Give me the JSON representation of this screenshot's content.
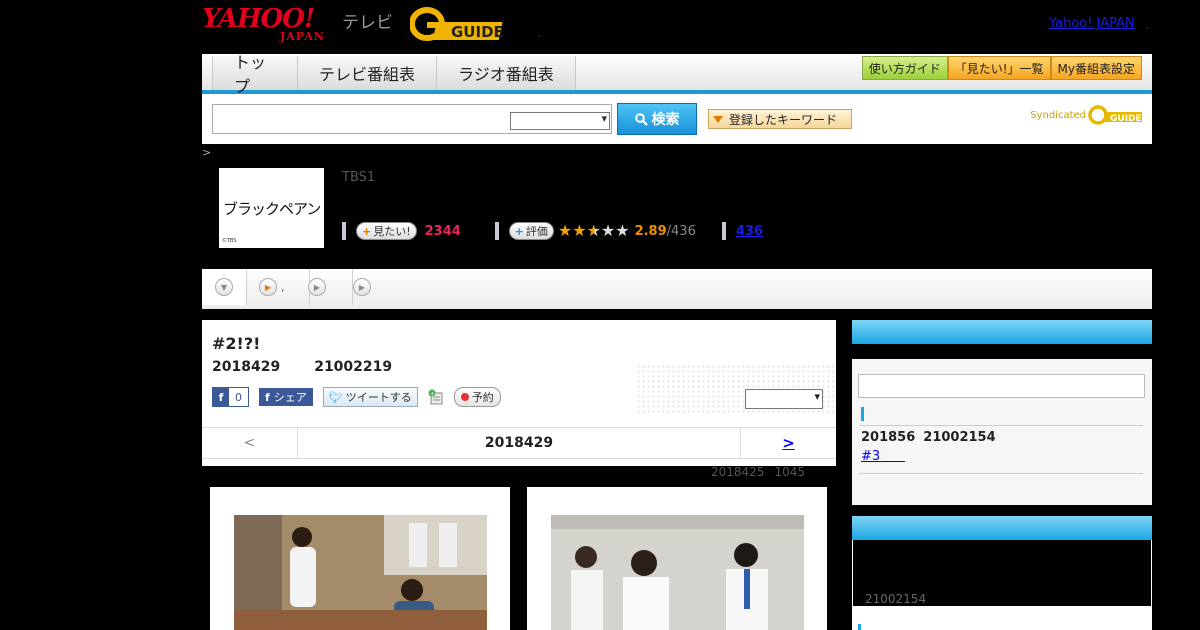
{
  "header": {
    "yahoo_logo_main": "YAHOO!",
    "yahoo_logo_sub": "JAPAN",
    "tv_label": "テレビ",
    "gguide_logo": "GUIDE",
    "yahoo_japan_link": "Yahoo! JAPAN"
  },
  "nav": {
    "tabs": [
      "トップ",
      "テレビ番組表",
      "ラジオ番組表"
    ],
    "buttons": [
      "使い方ガイド",
      "「見たい!」一覧",
      "My番組表設定"
    ]
  },
  "search": {
    "button_label": "検索",
    "keywords_button": "登録したキーワード",
    "syndicated_label": "Syndicated",
    "syndicated_logo": "GUIDE"
  },
  "breadcrumb": ">",
  "program": {
    "thumbnail_title": "ブラックペアン",
    "thumbnail_credit": "©TBS",
    "channel": "TBS1",
    "mitai_label": "見たい!",
    "mitai_count": "2344",
    "rating_label": "評価",
    "rating_value": "2.89",
    "rating_count": "/436",
    "rating_stars": 2.89,
    "reviews_link": "436"
  },
  "subtabs": [
    ",",
    "",
    ""
  ],
  "episode": {
    "title": "#2!?!",
    "date": "2018429",
    "time": "21002219",
    "fb_like_count": "0",
    "fb_share_label": "シェア",
    "tweet_label": "ツイートする",
    "reserve_label": "予約",
    "pager_prev": "<",
    "pager_current": "2018429",
    "pager_next": ">",
    "updated_date": "2018425",
    "updated_time": "1045"
  },
  "sidebar": {
    "next_date": "201856",
    "next_time": "21002154",
    "next_link": "#3",
    "box2_code": "21002154"
  },
  "colors": {
    "accent_blue": "#1a9ad6",
    "mitai_pink": "#e8265a",
    "rating_orange": "#f09000",
    "brand_red": "#e3001b"
  }
}
